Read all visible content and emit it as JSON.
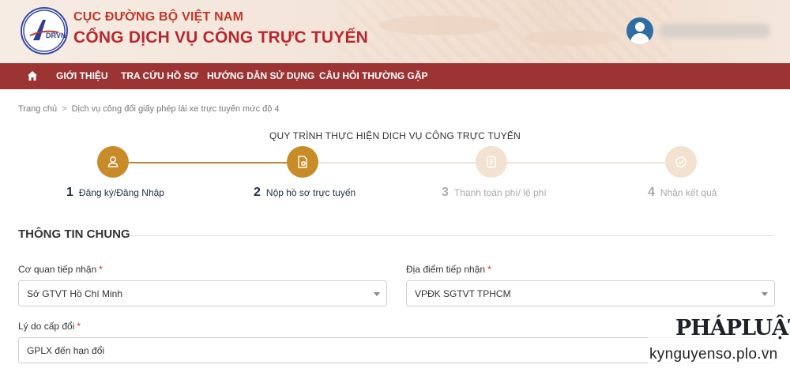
{
  "header": {
    "org_name": "CỤC ĐƯỜNG BỘ VIỆT NAM",
    "portal_name": "CỔNG DỊCH VỤ CÔNG TRỰC TUYẾN",
    "logo_text": "DRVN",
    "logo_icon": "drvn-logo"
  },
  "nav": {
    "home_icon": "home-icon",
    "items": [
      "GIỚI THIỆU",
      "TRA CỨU HỒ SƠ",
      "HƯỚNG DẪN SỬ DỤNG",
      "CÂU HỎI THƯỜNG GẶP"
    ]
  },
  "breadcrumb": {
    "home": "Trang chủ",
    "separator": ">",
    "current": "Dịch vụ công đổi giấy phép lái xe trực tuyến mức độ 4"
  },
  "steps": {
    "title": "QUY TRÌNH THỰC HIỆN DỊCH VỤ CÔNG TRỰC TUYẾN",
    "items": [
      {
        "num": "1",
        "label": "Đăng ký/Đăng Nhập",
        "icon": "user-icon",
        "state": "done"
      },
      {
        "num": "2",
        "label": "Nộp hồ sơ trực tuyến",
        "icon": "document-add-icon",
        "state": "active"
      },
      {
        "num": "3",
        "label": "Thanh toán phí/ lệ phí",
        "icon": "receipt-icon",
        "state": "pending"
      },
      {
        "num": "4",
        "label": "Nhận kết quả",
        "icon": "check-circle-icon",
        "state": "pending"
      }
    ]
  },
  "section": {
    "title": "THÔNG TIN CHUNG"
  },
  "form": {
    "agency_label": "Cơ quan tiếp nhận",
    "agency_value": "Sở GTVT Hồ Chí Minh",
    "location_label": "Địa điểm tiếp nhận",
    "location_value": "VPĐK SGTVT TPHCM",
    "reason_label": "Lý do cấp đổi",
    "reason_value": "GPLX đến hạn đổi",
    "required_mark": "*"
  },
  "watermark": {
    "logo": "PHÁPLUẬT",
    "url": "kynguyenso.plo.vn"
  },
  "colors": {
    "brand_red": "#b8292f",
    "nav_bg": "#9c3434",
    "step_active": "#c98a28",
    "step_inactive": "#f2e2cf"
  }
}
